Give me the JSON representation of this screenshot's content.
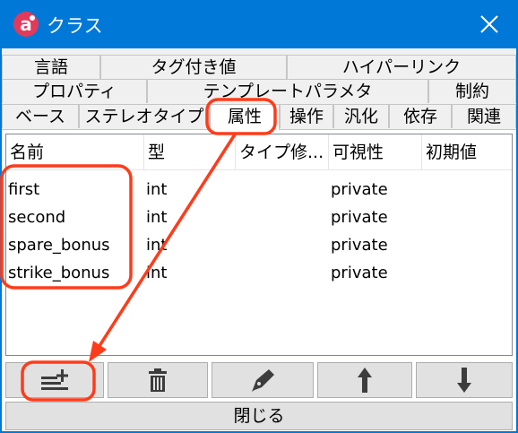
{
  "window": {
    "title": "クラス",
    "close_symbol": "✕"
  },
  "tabs": {
    "row1": [
      "言語",
      "タグ付き値",
      "ハイパーリンク"
    ],
    "row2": [
      "プロパティ",
      "テンプレートパラメタ",
      "制約"
    ],
    "row3": [
      "ベース",
      "ステレオタイプ",
      "属性",
      "操作",
      "汎化",
      "依存",
      "関連"
    ],
    "selected": "属性"
  },
  "table": {
    "columns": [
      "名前",
      "型",
      "タイプ修...",
      "可視性",
      "初期値"
    ],
    "rows": [
      {
        "name": "first",
        "type": "int",
        "visibility": "private"
      },
      {
        "name": "second",
        "type": "int",
        "visibility": "private"
      },
      {
        "name": "spare_bonus",
        "type": "int",
        "visibility": "private"
      },
      {
        "name": "strike_bonus",
        "type": "int",
        "visibility": "private"
      }
    ]
  },
  "toolbar": {
    "buttons": [
      "add-attribute-icon",
      "delete-icon",
      "edit-pen-icon",
      "move-up-icon",
      "move-down-icon"
    ]
  },
  "footer": {
    "close_label": "閉じる"
  },
  "colors": {
    "titlebar": "#0078d7",
    "annotation": "#ff3b1a",
    "icon": "#3c3c3c"
  }
}
